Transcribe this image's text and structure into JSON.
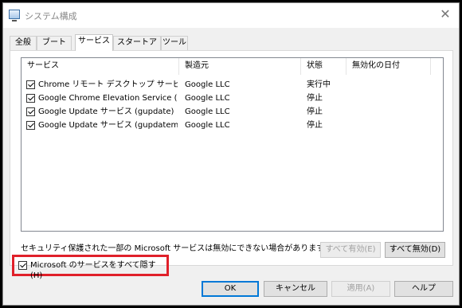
{
  "window": {
    "title": "システム構成",
    "close_glyph": "✕"
  },
  "tabs": [
    {
      "label": "全般",
      "active": false
    },
    {
      "label": "ブート",
      "active": false
    },
    {
      "label": "サービス",
      "active": true
    },
    {
      "label": "スタートアップ",
      "active": false
    },
    {
      "label": "ツール",
      "active": false
    }
  ],
  "columns": {
    "service": "サービス",
    "vendor": "製造元",
    "status": "状態",
    "disabled_date": "無効化の日付"
  },
  "rows": [
    {
      "checked": true,
      "service": "Chrome リモート デスクトップ サービス",
      "vendor": "Google LLC",
      "status": "実行中",
      "disabled_date": ""
    },
    {
      "checked": true,
      "service": "Google Chrome Elevation Service (G...",
      "vendor": "Google LLC",
      "status": "停止",
      "disabled_date": ""
    },
    {
      "checked": true,
      "service": "Google Update サービス (gupdate)",
      "vendor": "Google LLC",
      "status": "停止",
      "disabled_date": ""
    },
    {
      "checked": true,
      "service": "Google Update サービス (gupdatem)",
      "vendor": "Google LLC",
      "status": "停止",
      "disabled_date": ""
    }
  ],
  "notice": "セキュリティ保護された一部の Microsoft サービスは無効にできない場合があります。",
  "buttons": {
    "enable_all": "すべて有効(E)",
    "disable_all": "すべて無効(D)",
    "ok": "OK",
    "cancel": "キャンセル",
    "apply": "適用(A)",
    "help": "ヘルプ"
  },
  "hide_ms": {
    "checked": true,
    "label": "Microsoft のサービスをすべて隠す(H)"
  },
  "colors": {
    "highlight_border": "#e0202a",
    "accent": "#0078d7"
  }
}
